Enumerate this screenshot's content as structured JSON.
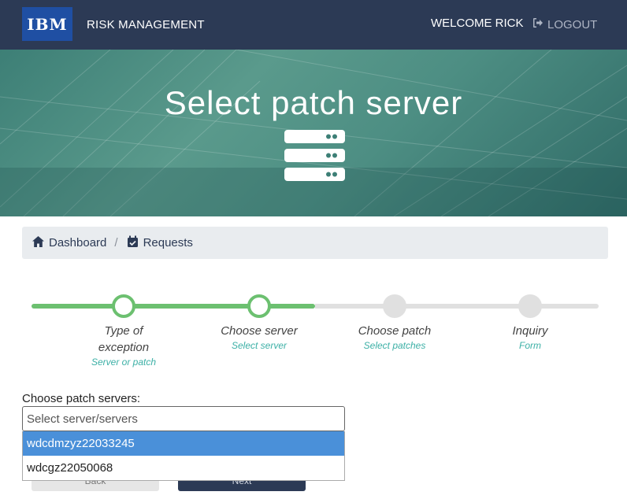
{
  "navbar": {
    "logo_text": "IBM",
    "brand": "RISK MANAGEMENT",
    "welcome": "WELCOME RICK",
    "logout": "LOGOUT"
  },
  "hero": {
    "title": "Select patch server",
    "icon": "server-stack-icon"
  },
  "breadcrumb": {
    "items": [
      {
        "label": "Dashboard",
        "icon": "home-icon"
      },
      {
        "label": "Requests",
        "icon": "calendar-check-icon"
      }
    ],
    "separator": "/"
  },
  "stepper": {
    "progress": 0.5,
    "colors": {
      "done": "#6cc070",
      "todo": "#e0e0e0",
      "sub": "#3cb0a6"
    },
    "steps": [
      {
        "title_line1": "Type of",
        "title_line2": "exception",
        "subtitle": "Server or patch",
        "status": "done"
      },
      {
        "title_line1": "Choose server",
        "title_line2": "",
        "subtitle": "Select server",
        "status": "done"
      },
      {
        "title_line1": "Choose patch",
        "title_line2": "",
        "subtitle": "Select patches",
        "status": "todo"
      },
      {
        "title_line1": "Inquiry",
        "title_line2": "",
        "subtitle": "Form",
        "status": "todo"
      }
    ]
  },
  "form": {
    "label": "Choose patch servers:",
    "placeholder": "Select server/servers",
    "value": "",
    "options": [
      {
        "label": "wdcdmzyz22033245",
        "highlighted": true
      },
      {
        "label": "wdcgz22050068",
        "highlighted": false
      }
    ]
  },
  "buttons": {
    "back": "Back",
    "next": "Next"
  },
  "colors": {
    "navbar": "#2c3a55",
    "accent": "#4a90d9"
  }
}
